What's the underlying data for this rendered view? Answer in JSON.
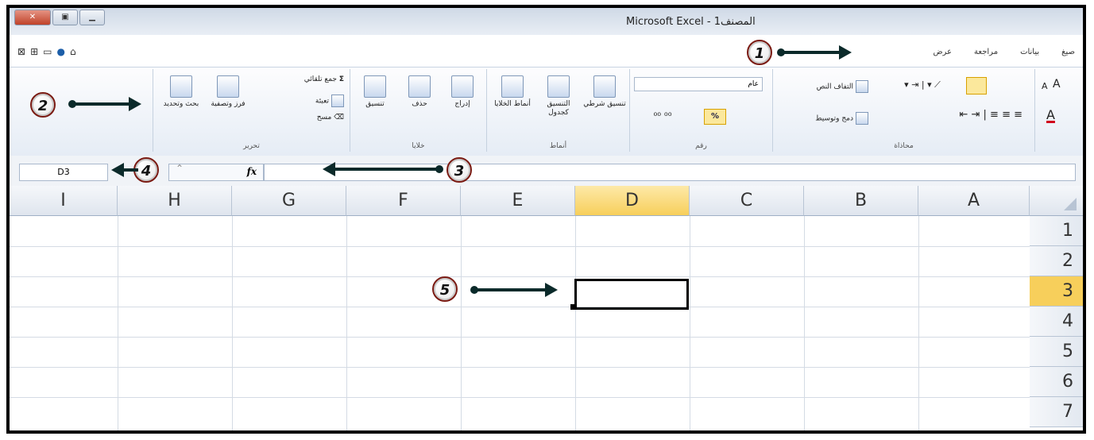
{
  "window": {
    "title": "Microsoft Excel - المصنف1",
    "minimize": "▁",
    "restore": "▣",
    "close": "✕"
  },
  "qat": [
    "⊠",
    "⊞",
    "▭",
    "●",
    "⌂"
  ],
  "tabs": [
    "صيغ",
    "بيانات",
    "مراجعة",
    "عرض"
  ],
  "ribbon": {
    "editing": {
      "label": "تحرير",
      "autosum": "جمع تلقائي",
      "fill": "تعبئة",
      "clear": "مسح",
      "sort": "فرز وتصفية",
      "find": "بحث وتحديد"
    },
    "cells": {
      "label": "خلايا",
      "insert": "إدراج",
      "delete": "حذف",
      "format": "تنسيق"
    },
    "styles": {
      "label": "أنماط",
      "conditional": "تنسيق شرطي",
      "table": "التنسيق كجدول",
      "cell": "أنماط الخلايا"
    },
    "number": {
      "label": "رقم",
      "format_value": "عام",
      "percent": "%"
    },
    "alignment": {
      "label": "محاذاة",
      "wrap": "التفاف النص",
      "merge": "دمج وتوسيط"
    },
    "font": {
      "grow": "A",
      "shrink": "A",
      "color": "A"
    }
  },
  "formula_bar": {
    "name_box": "D3",
    "fx": "fx",
    "value": ""
  },
  "grid": {
    "columns": [
      "I",
      "H",
      "G",
      "F",
      "E",
      "D",
      "C",
      "B",
      "A"
    ],
    "rows": [
      "1",
      "2",
      "3",
      "4",
      "5",
      "6",
      "7"
    ],
    "selected_column": "D",
    "selected_row": "3",
    "active_cell": "D3"
  },
  "callouts": [
    "1",
    "2",
    "3",
    "4",
    "5"
  ],
  "colors": {
    "selection": "#f7cf5b",
    "arrow": "#0b2a2a",
    "callout_border": "#7a1a12"
  }
}
